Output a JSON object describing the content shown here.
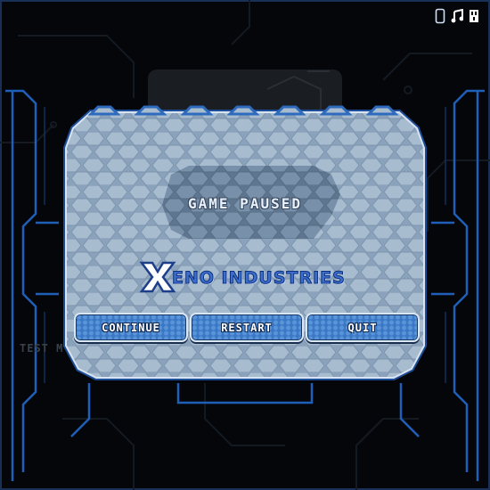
{
  "game": {
    "pause_title": "GAME PAUSED",
    "logo": {
      "x_letter": "X",
      "text": "ENO INDUSTRIES"
    },
    "buttons": {
      "continue": "CONTINUE",
      "restart": "RESTART",
      "quit": "QUIT"
    },
    "background_label": "TEST M"
  },
  "toolbar": {
    "icons": [
      "phone-icon",
      "music-note-icon",
      "sound-icon"
    ]
  },
  "colors": {
    "background": "#04060a",
    "circuit_blue": "#1f5fb8",
    "panel_border": "#2f6bbd",
    "hex_fill": "#9fb4c9",
    "button_fill": "#3a78c6",
    "logo_blue": "#3a6fd0"
  }
}
